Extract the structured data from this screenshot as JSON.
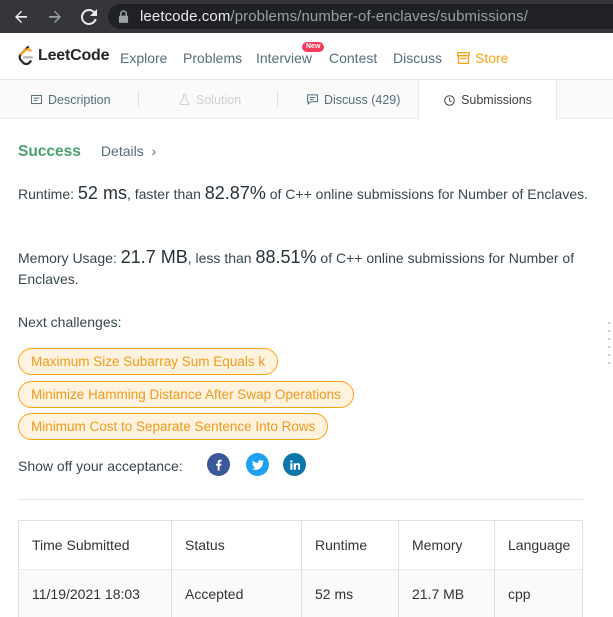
{
  "browser": {
    "url_host": "leetcode.com",
    "url_path": "/problems/number-of-enclaves/submissions/"
  },
  "nav": {
    "brand": "LeetCode",
    "links": [
      "Explore",
      "Problems",
      "Interview",
      "Contest",
      "Discuss"
    ],
    "new_badge": "New",
    "store": "Store"
  },
  "tabs": {
    "description": "Description",
    "solution": "Solution",
    "discuss": "Discuss (429)",
    "submissions": "Submissions"
  },
  "result": {
    "status": "Success",
    "details": "Details",
    "details_chevron": "›",
    "runtime_label": "Runtime:",
    "runtime_value": "52 ms",
    "runtime_mid": ", faster than",
    "runtime_pct": "82.87%",
    "runtime_tail": "of C++ online submissions for Number of Enclaves.",
    "memory_label": "Memory Usage:",
    "memory_value": "21.7 MB",
    "memory_mid": ", less than",
    "memory_pct": "88.51%",
    "memory_tail": "of C++ online submissions for Number of Enclaves."
  },
  "challenges": {
    "label": "Next challenges:",
    "items": [
      "Maximum Size Subarray Sum Equals k",
      "Minimize Hamming Distance After Swap Operations",
      "Minimum Cost to Separate Sentence Into Rows"
    ]
  },
  "share": {
    "label": "Show off your acceptance:",
    "icons": [
      "facebook-icon",
      "twitter-icon",
      "linkedin-icon"
    ],
    "colors": {
      "facebook": "#3b5998",
      "twitter": "#1da1f2",
      "linkedin": "#0e76a8"
    }
  },
  "table": {
    "headers": [
      "Time Submitted",
      "Status",
      "Runtime",
      "Memory",
      "Language"
    ],
    "rows": [
      [
        "11/19/2021 18:03",
        "Accepted",
        "52 ms",
        "21.7 MB",
        "cpp"
      ]
    ]
  },
  "colors": {
    "accent": "#ffa116",
    "success": "#4c9f70"
  }
}
